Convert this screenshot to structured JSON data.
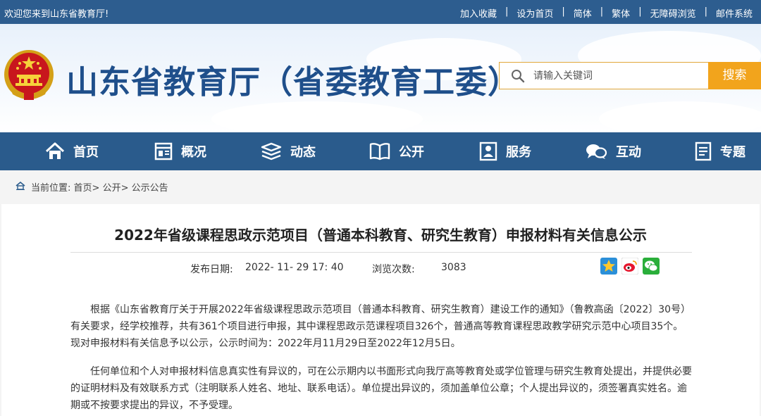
{
  "topbar": {
    "welcome": "欢迎您来到山东省教育厅!",
    "links": [
      "加入收藏",
      "设为首页",
      "简体",
      "繁体",
      "无障碍浏览",
      "邮件系统"
    ]
  },
  "header": {
    "site_title": "山东省教育厅（省委教育工委）",
    "search_placeholder": "请输入关键词",
    "search_button": "搜索"
  },
  "nav": {
    "items": [
      {
        "label": "首页",
        "icon": "home-icon"
      },
      {
        "label": "概况",
        "icon": "overview-icon"
      },
      {
        "label": "动态",
        "icon": "news-stack-icon"
      },
      {
        "label": "公开",
        "icon": "open-book-icon"
      },
      {
        "label": "服务",
        "icon": "service-icon"
      },
      {
        "label": "互动",
        "icon": "chat-bubbles-icon"
      },
      {
        "label": "专题",
        "icon": "document-icon"
      }
    ]
  },
  "breadcrumb": {
    "prefix": "当前位置:",
    "items": [
      "首页",
      "公开",
      "公示公告"
    ],
    "separator": ">"
  },
  "article": {
    "title": "2022年省级课程思政示范项目（普通本科教育、研究生教育）申报材料有关信息公示",
    "publish_label": "发布日期:",
    "publish_date": "2022- 11- 29 17: 40",
    "views_label": "浏览次数:",
    "views": "3083",
    "share_icons": [
      "qzone-star-icon",
      "weibo-icon",
      "wechat-icon"
    ],
    "paragraphs": [
      "根据《山东省教育厅关于开展2022年省级课程思政示范项目（普通本科教育、研究生教育）建设工作的通知》（鲁教高函〔2022〕30号）有关要求，经学校推荐，共有361个项目进行申报，其中课程思政示范课程项目326个，普通高等教育课程思政教学研究示范中心项目35个。现对申报材料有关信息予以公示，公示时间为：2022年月11月29日至2022年12月5日。",
      "任何单位和个人对申报材料信息真实性有异议的，可在公示期内以书面形式向我厅高等教育处或学位管理与研究生教育处提出，并提供必要的证明材料及有效联系方式（注明联系人姓名、地址、联系电话）。单位提出异议的，须加盖单位公章；个人提出异议的，须签署真实姓名。逾期或不按要求提出的异议，不予受理。"
    ]
  },
  "colors": {
    "topbar": "#2d5d8f",
    "nav": "#2a5b8c",
    "title_blue": "#1f4f8b",
    "search_button": "#f2a41c"
  }
}
